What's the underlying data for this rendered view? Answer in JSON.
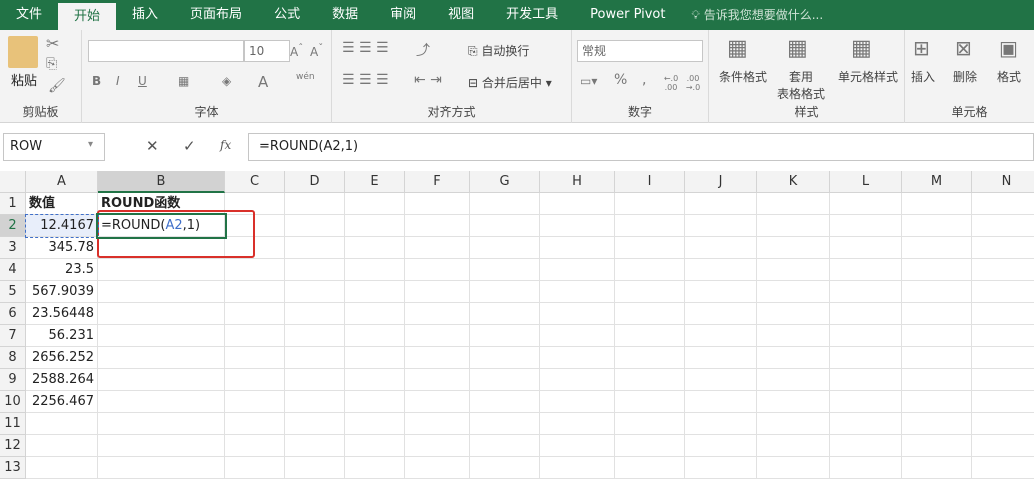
{
  "tabs": [
    "文件",
    "开始",
    "插入",
    "页面布局",
    "公式",
    "数据",
    "审阅",
    "视图",
    "开发工具",
    "Power Pivot"
  ],
  "active_tab": "开始",
  "tell_me": "告诉我您想要做什么...",
  "ribbon": {
    "clipboard": {
      "label": "剪贴板",
      "paste": "粘贴"
    },
    "font": {
      "label": "字体",
      "font_name": "",
      "font_size": "10",
      "bold": "B",
      "italic": "I",
      "underline": "U",
      "font_color": "A",
      "phonetic": "wén"
    },
    "alignment": {
      "label": "对齐方式",
      "wrap": "自动换行",
      "merge": "合并后居中"
    },
    "number": {
      "label": "数字",
      "format": "常规",
      "percent": "%",
      "comma": ",",
      "inc": "←.0 .00",
      "dec": ".00 →.0"
    },
    "styles": {
      "label": "样式",
      "conditional": "条件格式",
      "table_a": "套用",
      "table_b": "表格格式",
      "cell_styles": "单元格样式"
    },
    "cells": {
      "label": "单元格",
      "insert": "插入",
      "delete": "删除",
      "format": "格式"
    }
  },
  "formula_bar": {
    "name_box": "ROW",
    "formula": "=ROUND(A2,1)",
    "cancel": "✕",
    "enter": "✓",
    "fx": "fx"
  },
  "columns": [
    "A",
    "B",
    "C",
    "D",
    "E",
    "F",
    "G",
    "H",
    "I",
    "J",
    "K",
    "L",
    "M",
    "N"
  ],
  "rows": [
    "1",
    "2",
    "3",
    "4",
    "5",
    "6",
    "7",
    "8",
    "9",
    "10",
    "11",
    "12",
    "13"
  ],
  "cells": {
    "A1": "数值",
    "B1": "ROUND函数",
    "A2": "12.4167",
    "A3": "345.78",
    "A4": "23.5",
    "A5": "567.9039",
    "A6": "23.56448",
    "A7": "56.231",
    "A8": "2656.252",
    "A9": "2588.264",
    "A10": "2256.467",
    "B2_prefix": "=ROUND(",
    "B2_ref": "A2",
    "B2_suffix": ",1)"
  },
  "colors": {
    "accent": "#217346",
    "ref": "#3f6fc9",
    "highlight": "#d9302a"
  }
}
